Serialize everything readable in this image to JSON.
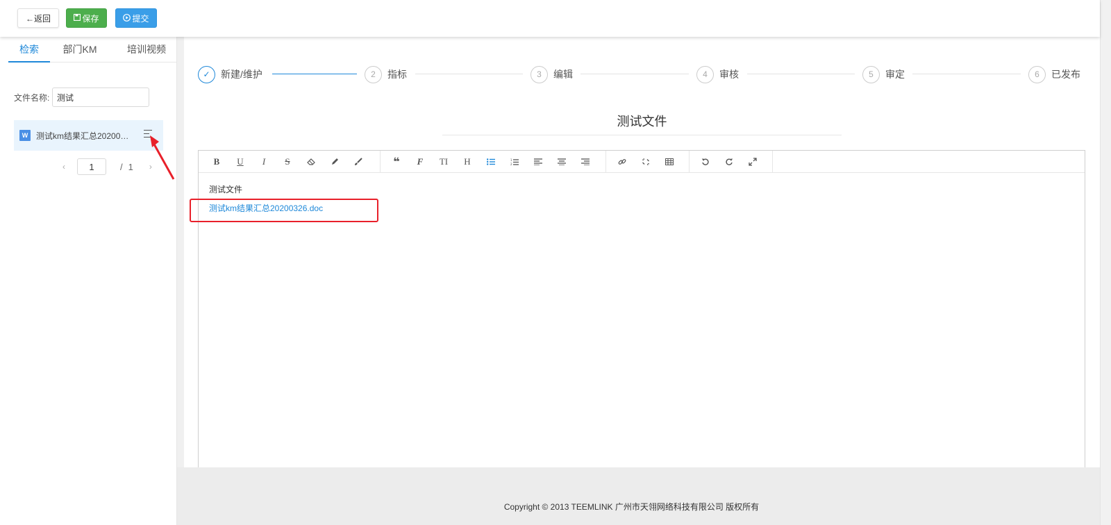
{
  "toolbar": {
    "back_label": "←返回",
    "save_label": "保存",
    "submit_label": "提交"
  },
  "sidebar": {
    "tabs": [
      {
        "label": "检索",
        "active": true
      },
      {
        "label": "部门KM",
        "active": false
      },
      {
        "label": "培训视频",
        "active": false
      }
    ],
    "filter": {
      "label": "文件名称:",
      "value": "测试"
    },
    "files": [
      {
        "icon": "word-icon",
        "icon_text": "W",
        "name": "测试km结果汇总20200326.doc"
      }
    ],
    "pager": {
      "prev": "‹",
      "current": "1",
      "sep": "/",
      "total": "1",
      "next": "›"
    }
  },
  "steps": [
    {
      "index": "✓",
      "label": "新建/维护",
      "done": true
    },
    {
      "index": "2",
      "label": "指标",
      "done": false
    },
    {
      "index": "3",
      "label": "编辑",
      "done": false
    },
    {
      "index": "4",
      "label": "审核",
      "done": false
    },
    {
      "index": "5",
      "label": "审定",
      "done": false
    },
    {
      "index": "6",
      "label": "已发布",
      "done": false
    }
  ],
  "document": {
    "title": "测试文件",
    "body_text": "测试文件",
    "attachment_link": "测试km结果汇总20200326.doc"
  },
  "editor_toolbar": {
    "bold": "B",
    "underline": "U",
    "italic": "I",
    "strike": "S",
    "font": "F",
    "text_size": "TI",
    "heading": "H"
  },
  "footer": {
    "copyright": "Copyright © 2013 TEEMLINK 广州市天翎网络科技有限公司 版权所有"
  },
  "colors": {
    "accent": "#1e88d9",
    "save_green": "#4cae4c",
    "submit_blue": "#3a9ee8",
    "annotation_red": "#e8202a"
  }
}
